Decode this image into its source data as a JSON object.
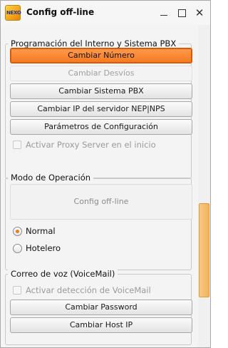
{
  "window": {
    "title": "Config off-line",
    "icon_text": "NEXO",
    "controls": {
      "minimize": "minimize-icon",
      "maximize": "maximize-icon",
      "close": "close-icon"
    }
  },
  "group_pbx": {
    "title": "Programación del Interno y Sistema PBX",
    "buttons": [
      {
        "label": "Cambiar Número",
        "state": "active"
      },
      {
        "label": "Cambiar Desvíos",
        "state": "disabled"
      },
      {
        "label": "Cambiar Sistema PBX",
        "state": "normal"
      },
      {
        "label": "Cambiar IP del servidor NEP|NPS",
        "state": "normal"
      },
      {
        "label": "Parámetros de Configuración",
        "state": "normal"
      }
    ],
    "proxy_checkbox": {
      "label": "Activar Proxy Server en el inicio",
      "checked": false,
      "enabled": false
    }
  },
  "group_mode": {
    "title": "Modo de Operación",
    "mode_button": {
      "label": "Config off-line",
      "enabled": false
    },
    "radios": [
      {
        "label": "Normal",
        "selected": true
      },
      {
        "label": "Hotelero",
        "selected": false
      }
    ]
  },
  "group_voicemail": {
    "title": "Correo de voz (VoiceMail)",
    "detect_checkbox": {
      "label": "Activar detección de VoiceMail",
      "checked": false,
      "enabled": false
    },
    "buttons": [
      {
        "label": "Cambiar Password"
      },
      {
        "label": "Cambiar Host IP"
      }
    ]
  },
  "colors": {
    "accent": "#f47a20",
    "scroll_thumb": "#f2b35e",
    "radio_selected": "#e8801a"
  }
}
